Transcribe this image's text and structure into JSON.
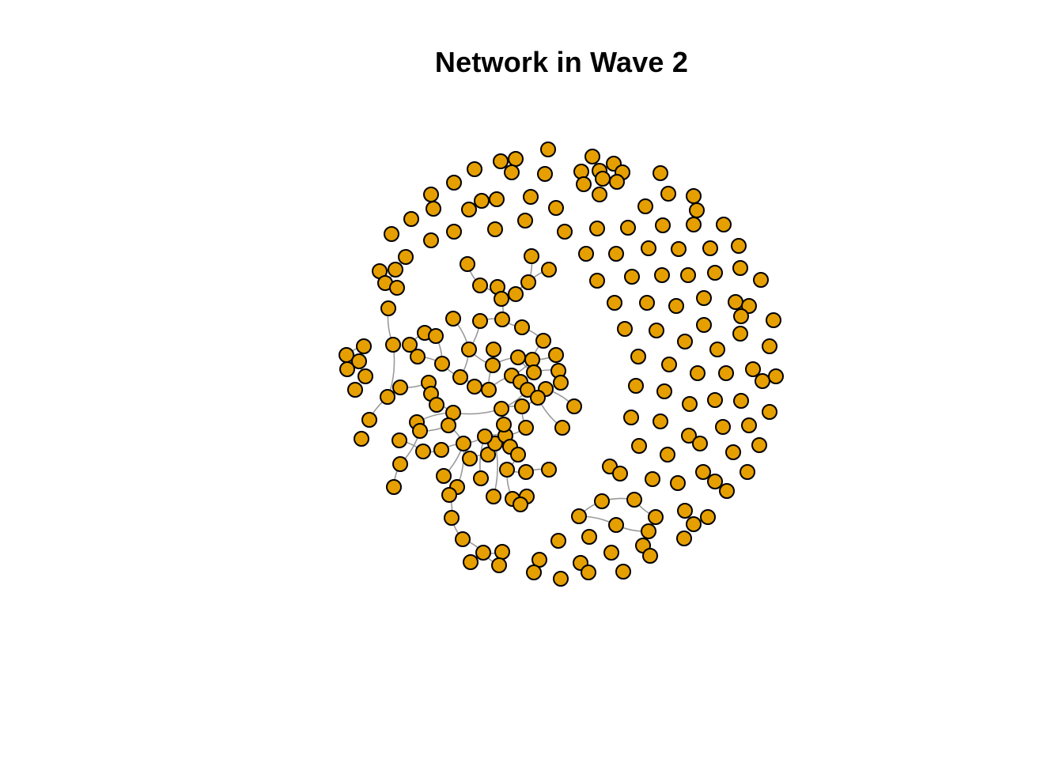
{
  "title": "Network in Wave 2",
  "colors": {
    "background": "#ffffff",
    "node_fill": "#e69f00",
    "node_stroke": "#000000",
    "edge": "#9a9a9a"
  }
}
